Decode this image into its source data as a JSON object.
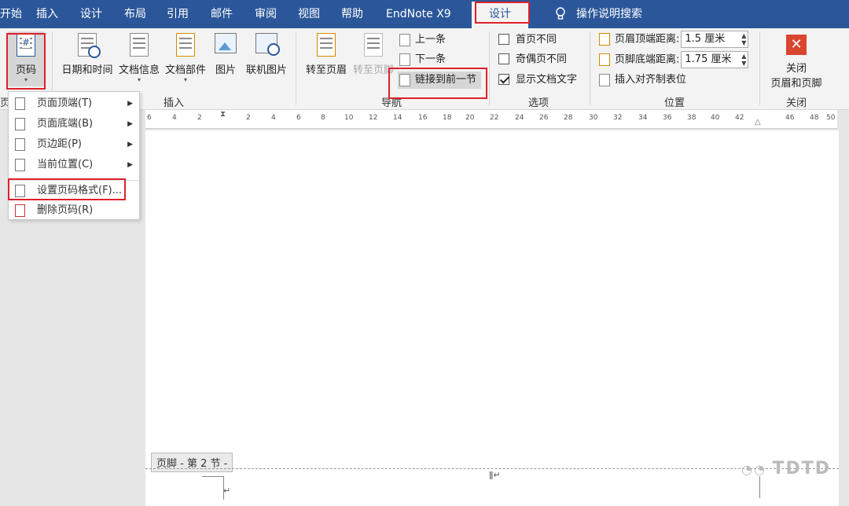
{
  "tabs": [
    "开始",
    "插入",
    "设计",
    "布局",
    "引用",
    "邮件",
    "审阅",
    "视图",
    "帮助",
    "EndNote X9"
  ],
  "active_tab": "设计",
  "tell_me": "操作说明搜索",
  "groups": {
    "header_footer_label": "页眉",
    "insert_label": "插入",
    "nav_label": "导航",
    "options_label": "选项",
    "position_label": "位置",
    "close_label": "关闭"
  },
  "buttons": {
    "page_number": "页码",
    "date_time": "日期和时间",
    "doc_info": "文档信息",
    "doc_parts": "文档部件",
    "picture": "图片",
    "online_picture": "联机图片",
    "goto_header": "转至页眉",
    "goto_footer": "转至页脚",
    "prev": "上一条",
    "next": "下一条",
    "link_prev": "链接到前一节",
    "close_line1": "关闭",
    "close_line2": "页眉和页脚",
    "insert_tab": "插入对齐制表位"
  },
  "options": {
    "diff_first": "首页不同",
    "diff_odd_even": "奇偶页不同",
    "show_doc_text": "显示文档文字"
  },
  "position": {
    "header_top_label": "页眉顶端距离:",
    "header_top_value": "1.5 厘米",
    "footer_bottom_label": "页脚底端距离:",
    "footer_bottom_value": "1.75 厘米"
  },
  "menu": [
    {
      "label": "页面顶端(T)",
      "arrow": "▶"
    },
    {
      "label": "页面底端(B)",
      "arrow": "▶"
    },
    {
      "label": "页边距(P)",
      "arrow": "▶"
    },
    {
      "label": "当前位置(C)",
      "arrow": "▶"
    },
    {
      "label": "设置页码格式(F)...",
      "arrow": ""
    },
    {
      "label": "删除页码(R)",
      "arrow": ""
    }
  ],
  "ruler_ticks": [
    "6",
    "4",
    "2",
    "2",
    "4",
    "6",
    "8",
    "10",
    "12",
    "14",
    "16",
    "18",
    "20",
    "22",
    "24",
    "26",
    "28",
    "30",
    "32",
    "34",
    "36",
    "38",
    "40",
    "42",
    "46",
    "48",
    "50"
  ],
  "footer_tag": "页脚 - 第 2 节 -",
  "watermark": "TDTD"
}
